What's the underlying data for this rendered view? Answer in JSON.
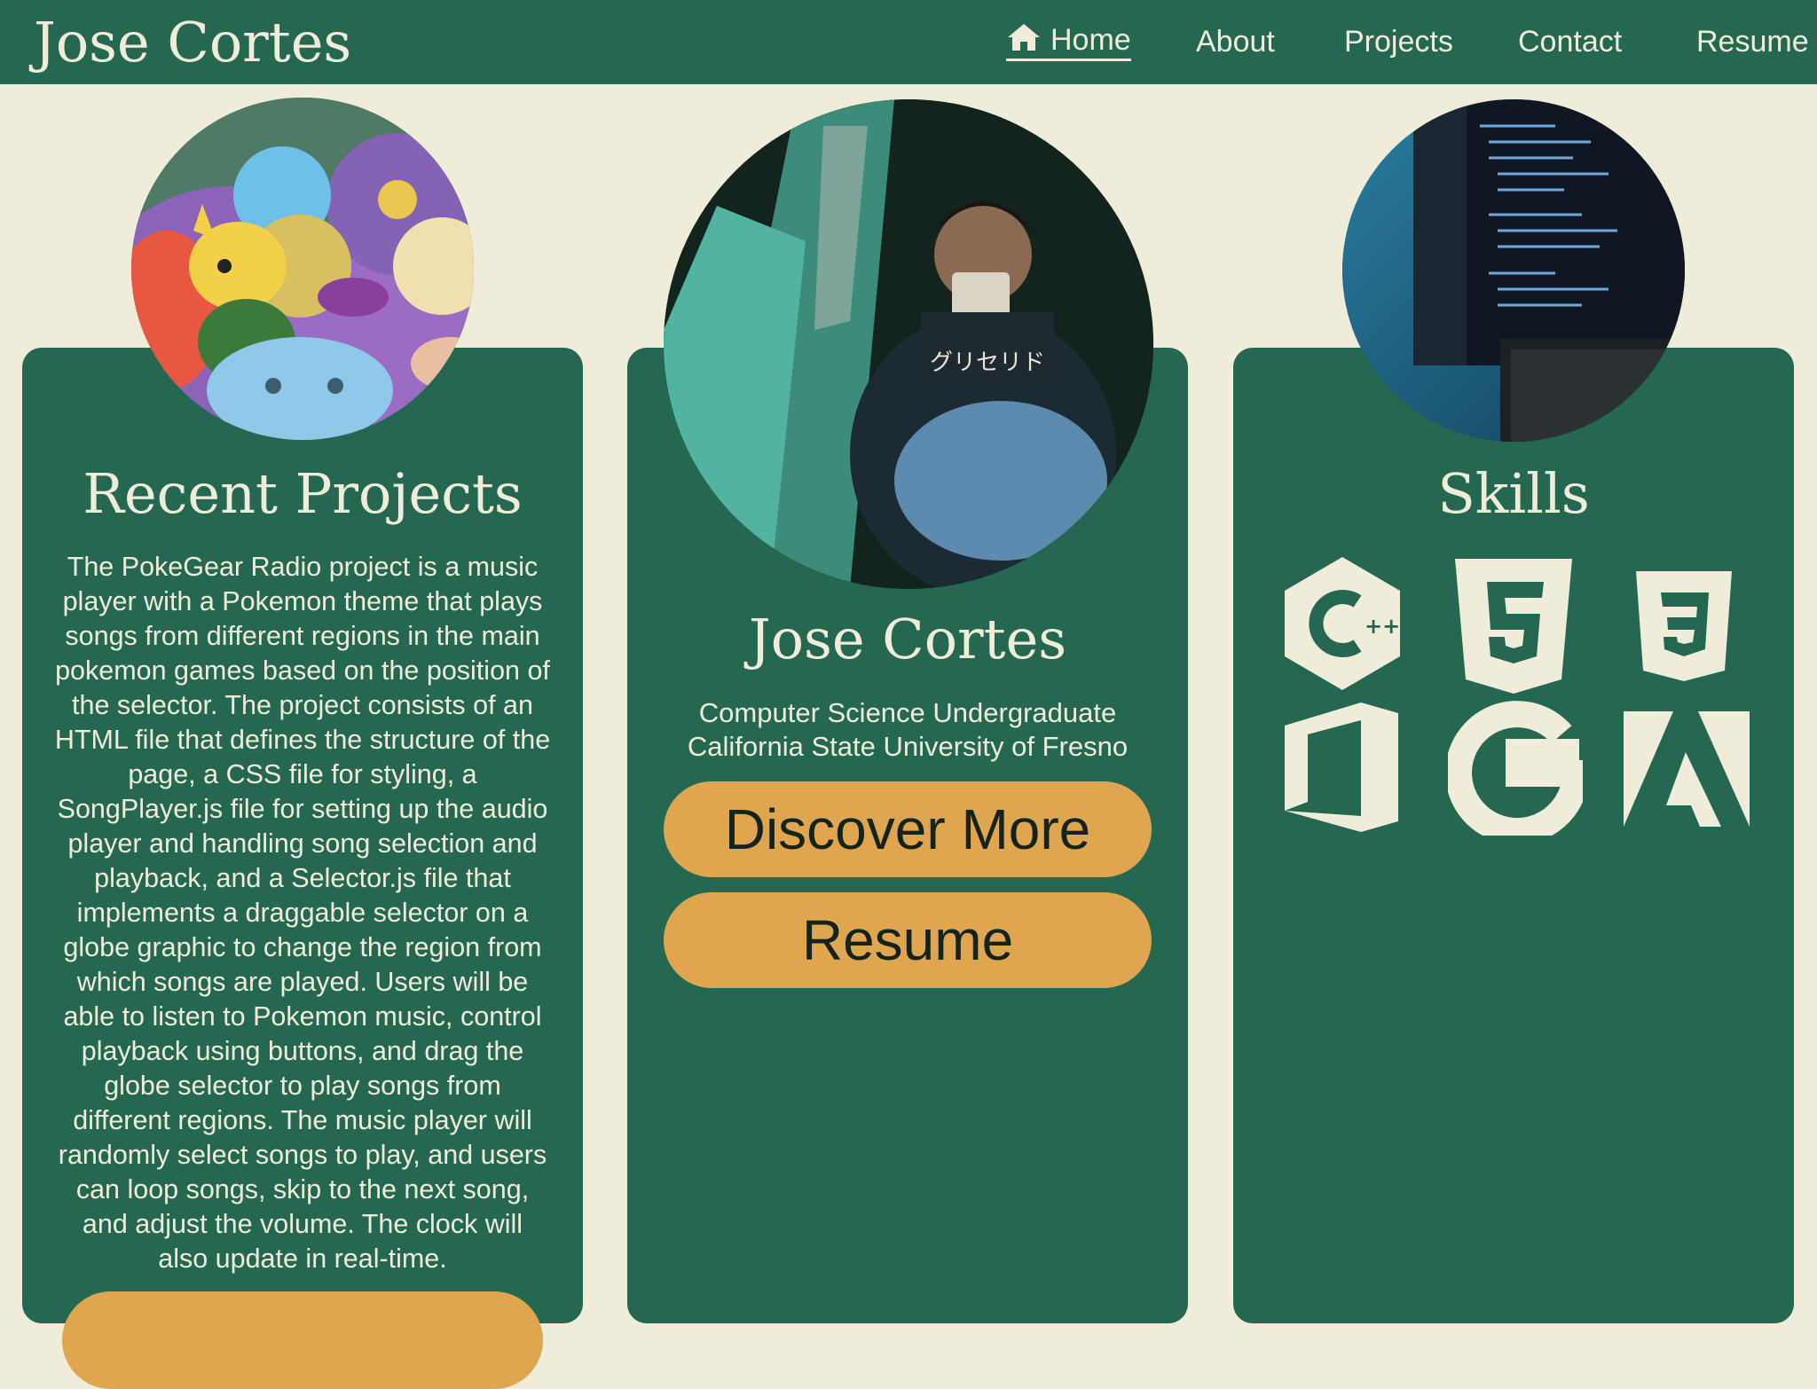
{
  "header": {
    "brand": "Jose Cortes",
    "nav": [
      {
        "label": "Home",
        "icon": "home-icon",
        "active": true
      },
      {
        "label": "About"
      },
      {
        "label": "Projects"
      },
      {
        "label": "Contact"
      },
      {
        "label": "Resume"
      }
    ]
  },
  "projects_card": {
    "title": "Recent Projects",
    "image": "pokemon-illustration",
    "description": "The PokeGear Radio project is a music player with a Pokemon theme that plays songs from different regions in the main pokemon games based on the position of the selector. The project consists of an HTML file that defines the structure of the page, a CSS file for styling, a SongPlayer.js file for setting up the audio player and handling song selection and playback, and a Selector.js file that implements a draggable selector on a globe graphic to change the region from which songs are played. Users will be able to listen to Pokemon music, control playback using buttons, and drag the globe selector to play songs from different regions. The music player will randomly select songs to play, and users can loop songs, skip to the next song, and adjust the volume. The clock will also update in real-time."
  },
  "profile_card": {
    "name": "Jose Cortes",
    "subtitle_line1": "Computer Science Undergraduate",
    "subtitle_line2": "California State University of Fresno",
    "discover_label": "Discover More",
    "resume_label": "Resume",
    "image": "profile-photo"
  },
  "skills_card": {
    "title": "Skills",
    "image": "code-monitors-photo",
    "icons": [
      "cplusplus-icon",
      "html5-icon",
      "css3-icon",
      "office-icon",
      "google-icon",
      "adobe-icon"
    ]
  },
  "colors": {
    "primary_green": "#256852",
    "cream": "#efecd9",
    "accent_gold": "#dfa54f"
  }
}
